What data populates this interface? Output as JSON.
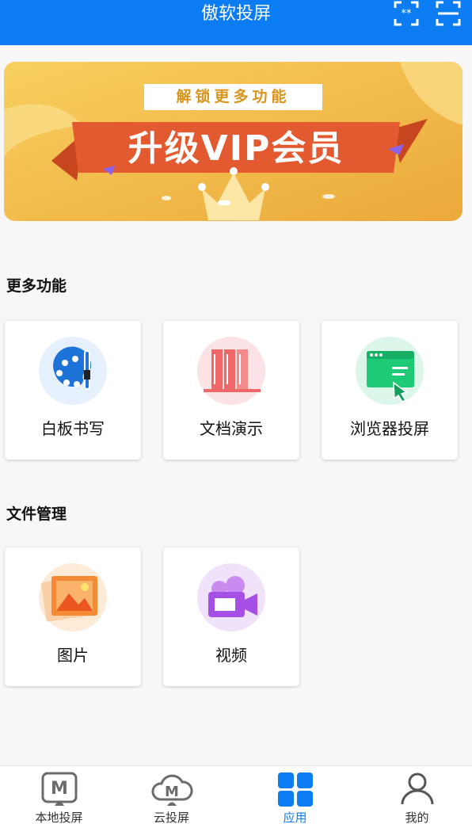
{
  "header": {
    "title": "傲软投屏"
  },
  "banner": {
    "subtitle": "解锁更多功能",
    "title": "升级VIP会员"
  },
  "sections": [
    {
      "title": "更多功能",
      "items": [
        {
          "label": "白板书写"
        },
        {
          "label": "文档演示"
        },
        {
          "label": "浏览器投屏"
        }
      ]
    },
    {
      "title": "文件管理",
      "items": [
        {
          "label": "图片"
        },
        {
          "label": "视频"
        }
      ]
    }
  ],
  "tabbar": {
    "items": [
      {
        "label": "本地投屏",
        "icon": "local-cast-icon"
      },
      {
        "label": "云投屏",
        "icon": "cloud-cast-icon"
      },
      {
        "label": "应用",
        "icon": "apps-icon",
        "active": true
      },
      {
        "label": "我的",
        "icon": "profile-icon"
      }
    ]
  },
  "colors": {
    "primary": "#0b7cf2",
    "banner": "#f2b84b",
    "ribbon": "#e35a30"
  }
}
